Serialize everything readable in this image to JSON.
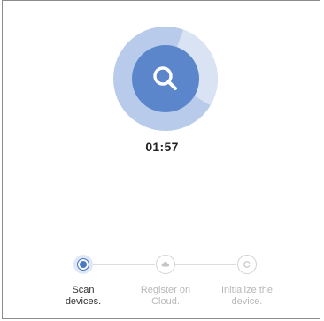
{
  "scan": {
    "icon": "search-icon",
    "progress_fraction": 0.28,
    "colors": {
      "outer_ring": "#b9cbea",
      "progress_wedge": "#d9e3f4",
      "center": "#5b86cc",
      "icon": "#ffffff"
    }
  },
  "timer": {
    "value": "01:57"
  },
  "steps": [
    {
      "label": "Scan\ndevices.",
      "state": "active",
      "icon": "radio-dot-icon"
    },
    {
      "label": "Register on\nCloud.",
      "state": "pending",
      "icon": "cloud-icon"
    },
    {
      "label": "Initialize the\ndevice.",
      "state": "pending",
      "icon": "initialize-icon"
    }
  ],
  "colors": {
    "active_step": "#4a78c4",
    "pending_text": "#b8b8b8",
    "connector_line": "#dddddd"
  }
}
